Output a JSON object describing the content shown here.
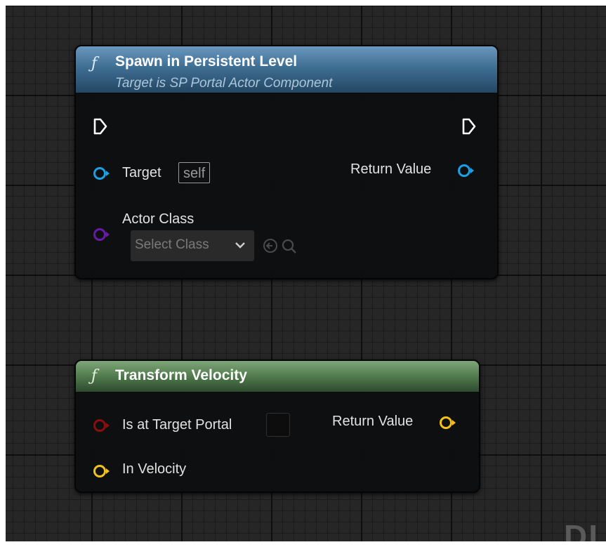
{
  "watermark": "DI",
  "nodes": [
    {
      "title": "Spawn in Persistent Level",
      "subtitle": "Target is SP Portal Actor Component",
      "func_icon": "function-icon",
      "header_color": "#3f6e93",
      "inputs": {
        "target_label": "Target",
        "target_value": "self",
        "actor_class_label": "Actor Class",
        "select_class_placeholder": "Select Class"
      },
      "outputs": {
        "return_label": "Return Value"
      }
    },
    {
      "title": "Transform Velocity",
      "func_icon": "function-icon",
      "header_color": "#557f51",
      "inputs": {
        "is_at_target_portal_label": "Is at Target Portal",
        "is_at_target_portal_checked": false,
        "in_velocity_label": "In Velocity"
      },
      "outputs": {
        "return_label": "Return Value"
      }
    }
  ],
  "pin_colors": {
    "exec": "#ffffff",
    "object": "#1aa0e6",
    "class": "#6a1aa8",
    "bool": "#8e0d0d",
    "vector": "#f2c21a"
  }
}
